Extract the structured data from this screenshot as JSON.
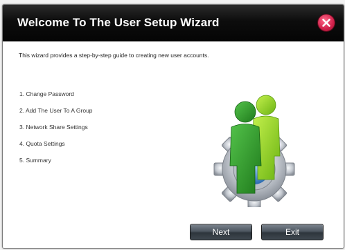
{
  "dialog": {
    "title": "Welcome To The User Setup Wizard",
    "close_icon": "close-icon"
  },
  "intro_text": "This wizard provides a step-by-step guide to creating new user accounts.",
  "steps": [
    "1. Change Password",
    "2. Add The User To A Group",
    "3. Network Share Settings",
    "4. Quota Settings",
    "5. Summary"
  ],
  "illustration_icon": "users-gear-icon",
  "buttons": {
    "next_label": "Next",
    "exit_label": "Exit"
  },
  "colors": {
    "title_bar": "#0d0d0d",
    "close_button": "#d0204a",
    "user_dark_green": "#2f9a2a",
    "user_light_green": "#8ad21e",
    "gear": "#b9bec6"
  }
}
